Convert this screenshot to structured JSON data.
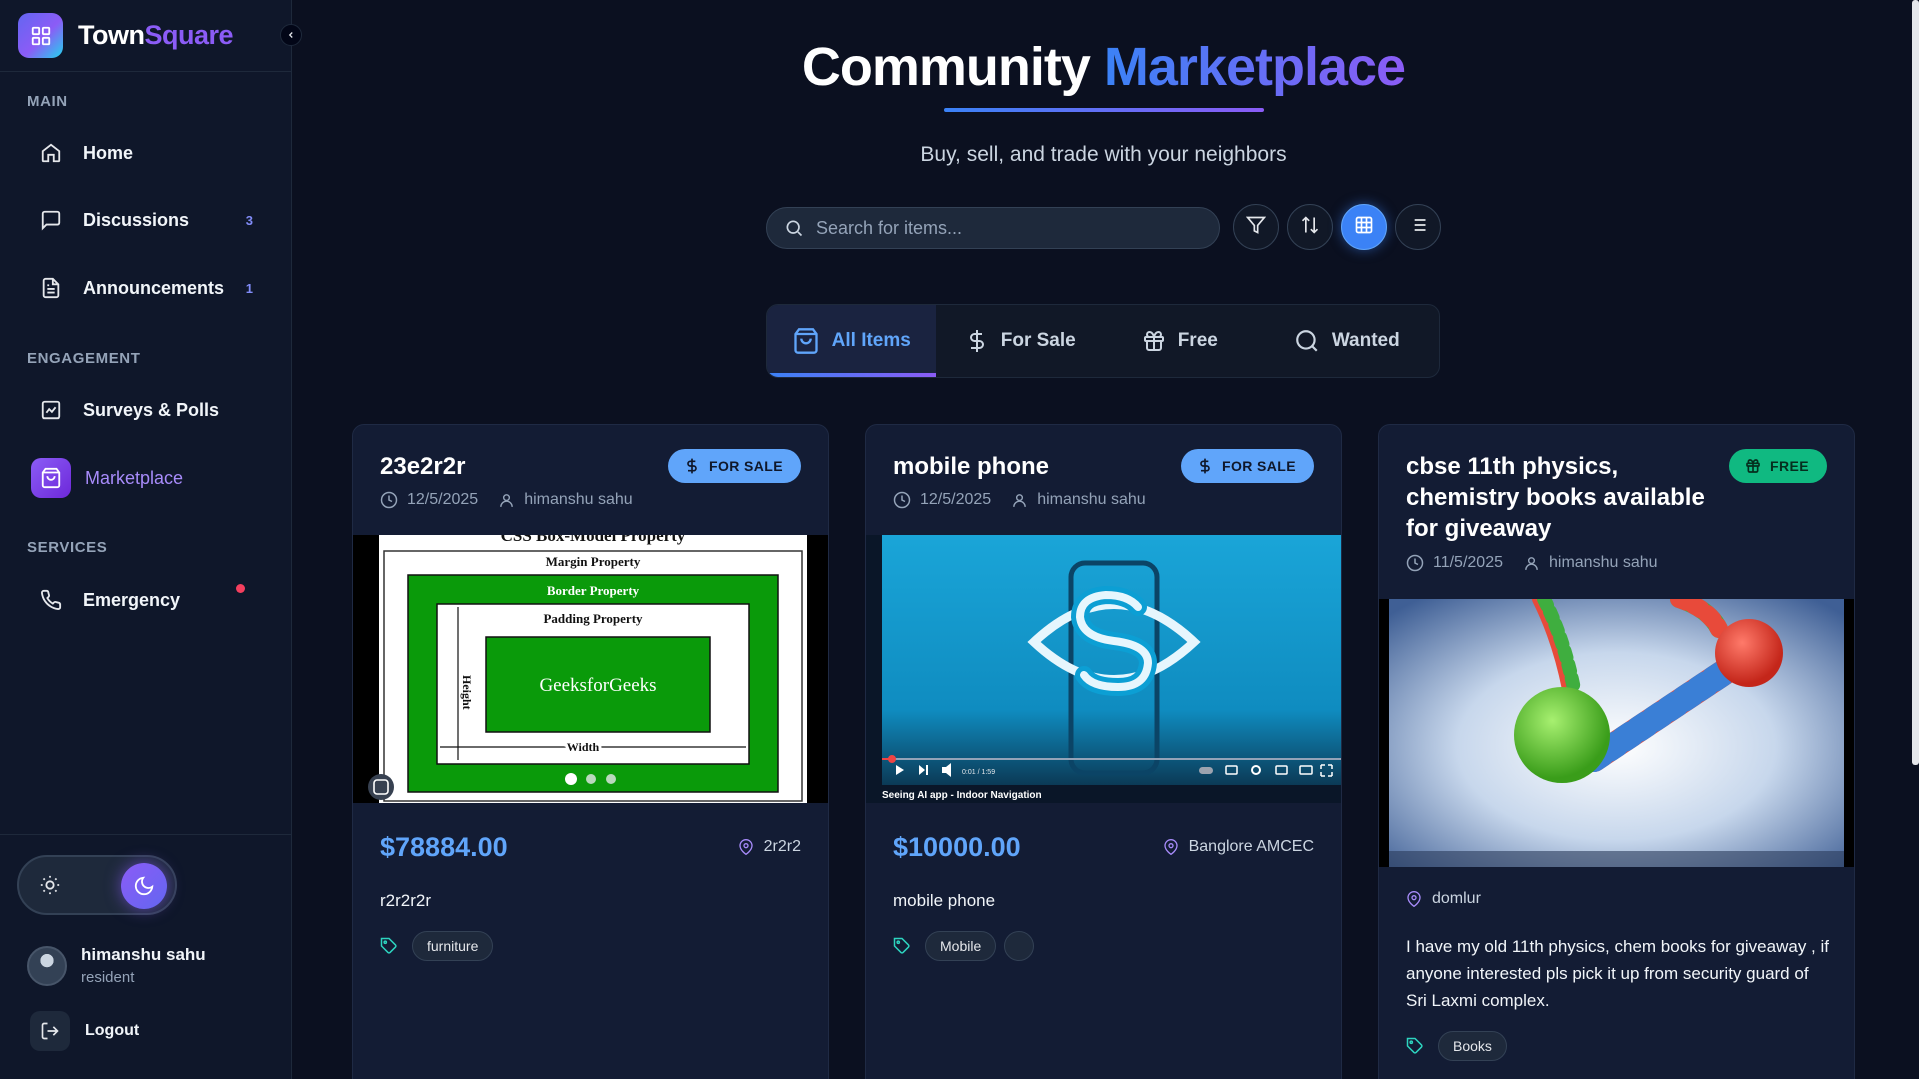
{
  "brand": {
    "part1": "Town",
    "part2": "Square"
  },
  "sidebar": {
    "sections": {
      "main": "MAIN",
      "engagement": "ENGAGEMENT",
      "services": "SERVICES"
    },
    "items": [
      {
        "label": "Home",
        "icon": "home-icon"
      },
      {
        "label": "Discussions",
        "icon": "message-square-icon",
        "count": "3"
      },
      {
        "label": "Announcements",
        "icon": "file-text-icon",
        "count": "1"
      },
      {
        "label": "Surveys & Polls",
        "icon": "chart-icon"
      },
      {
        "label": "Marketplace",
        "icon": "shopping-bag-icon",
        "active": true
      },
      {
        "label": "Emergency",
        "icon": "phone-icon",
        "alert": true
      }
    ],
    "user": {
      "name": "himanshu sahu",
      "role": "resident"
    },
    "logout": "Logout"
  },
  "page": {
    "title_part1": "Community",
    "title_part2": "Marketplace",
    "subtitle": "Buy, sell, and trade with your neighbors",
    "search_placeholder": "Search for items...",
    "tabs": [
      {
        "label": "All Items",
        "icon": "shopping-bag-icon",
        "active": true
      },
      {
        "label": "For Sale",
        "icon": "dollar-icon"
      },
      {
        "label": "Free",
        "icon": "gift-icon"
      },
      {
        "label": "Wanted",
        "icon": "search-icon"
      }
    ]
  },
  "cards": [
    {
      "title": "23e2r2r",
      "badge": "FOR SALE",
      "date": "12/5/2025",
      "author": "himanshu sahu",
      "price": "$78884.00",
      "location": "2r2r2",
      "description": "r2r2r2r",
      "tags": [
        "furniture"
      ],
      "media": {
        "heading": "CSS Box-Model Property",
        "margin": "Margin Property",
        "border": "Border Property",
        "padding": "Padding Property",
        "content": "GeeksforGeeks",
        "height": "Height",
        "width": "Width"
      }
    },
    {
      "title": "mobile phone",
      "badge": "FOR SALE",
      "date": "12/5/2025",
      "author": "himanshu sahu",
      "price": "$10000.00",
      "location": "Banglore AMCEC",
      "description": "mobile phone",
      "tags": [
        "Mobile"
      ],
      "media": {
        "caption": "Seeing AI app - Indoor Navigation",
        "time": "0:01 / 1:59"
      }
    },
    {
      "title_lines": [
        "cbse 11th physics,",
        "chemistry books available",
        "for giveaway"
      ],
      "badge": "FREE",
      "date": "11/5/2025",
      "author": "himanshu sahu",
      "location": "domlur",
      "description": "I have my old 11th physics, chem books for giveaway , if anyone interested pls pick it up from security guard of Sri Laxmi complex.",
      "tags": [
        "Books"
      ]
    }
  ],
  "colors": {
    "accent": "#3b82f6",
    "brand": "#8b5cf6",
    "free": "#10b981",
    "bg": "#0b1020"
  }
}
